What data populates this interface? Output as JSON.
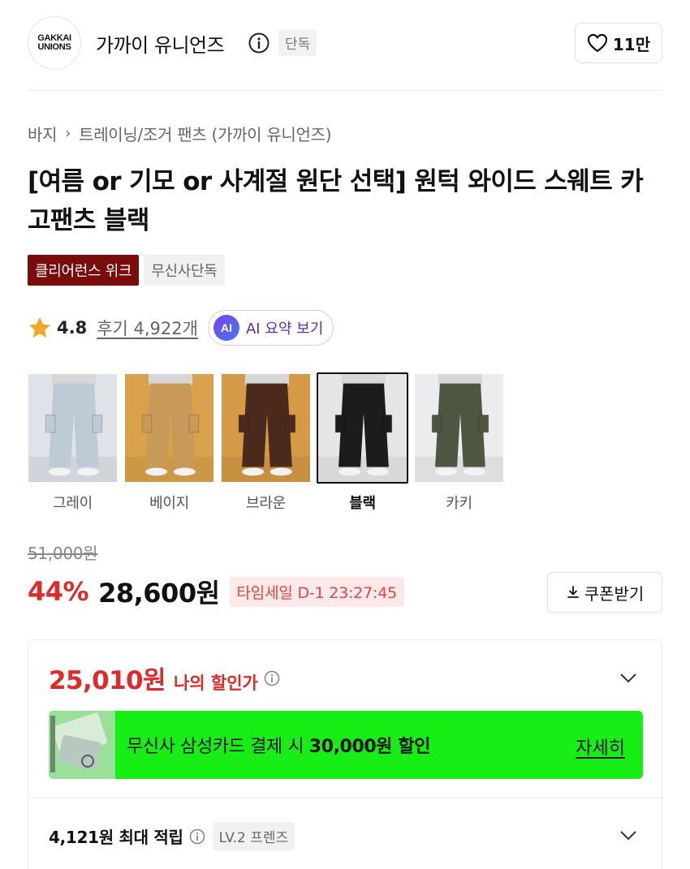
{
  "brand": {
    "logo_line1": "GAKKAI",
    "logo_line2": "UNIONS",
    "name": "가까이 유니언즈",
    "exclusive": "단독",
    "likes": "11만"
  },
  "breadcrumb": {
    "category": "바지",
    "separator": "›",
    "subcategory": "트레이닝/조거 팬츠 (가까이 유니언즈)"
  },
  "product": {
    "title": "[여름 or 기모 or 사계절 원단 선택] 원턱 와이드 스웨트 카고팬츠 블랙",
    "tags": [
      "클리어런스 위크",
      "무신사단독"
    ]
  },
  "rating": {
    "score": "4.8",
    "reviews": "후기 4,922개",
    "ai_badge": "AI",
    "ai_label": "AI 요약 보기"
  },
  "colors": [
    {
      "label": "그레이",
      "fabric": "#bccbd6",
      "bg": "#dfe2e6",
      "selected": false
    },
    {
      "label": "베이지",
      "fabric": "#c79a5a",
      "bg": "#d9a24a",
      "selected": false
    },
    {
      "label": "브라운",
      "fabric": "#4a2a1c",
      "bg": "#d49a45",
      "selected": false
    },
    {
      "label": "블랙",
      "fabric": "#1c1c1f",
      "bg": "#e6e6e8",
      "selected": true
    },
    {
      "label": "카키",
      "fabric": "#4e5642",
      "bg": "#ececee",
      "selected": false
    }
  ],
  "price": {
    "original": "51,000원",
    "discount_rate": "44%",
    "sale": "28,600원",
    "timesale": "타임세일 D-1 23:27:45",
    "coupon_label": "쿠폰받기"
  },
  "discount_card": {
    "my_price": "25,010원",
    "my_price_label": "나의 할인가",
    "banner_prefix": "무신사 삼성카드 결제 시 ",
    "banner_amount": "30,000원 할인",
    "banner_link": "자세히",
    "points": "4,121원 최대 적립",
    "level": "LV.2 프렌즈"
  },
  "colors_theme": {
    "accent_red": "#e02a2a",
    "banner_green": "#16ee16",
    "tag_red": "#7a0c0c",
    "ai_purple": "#5a2fc0"
  }
}
